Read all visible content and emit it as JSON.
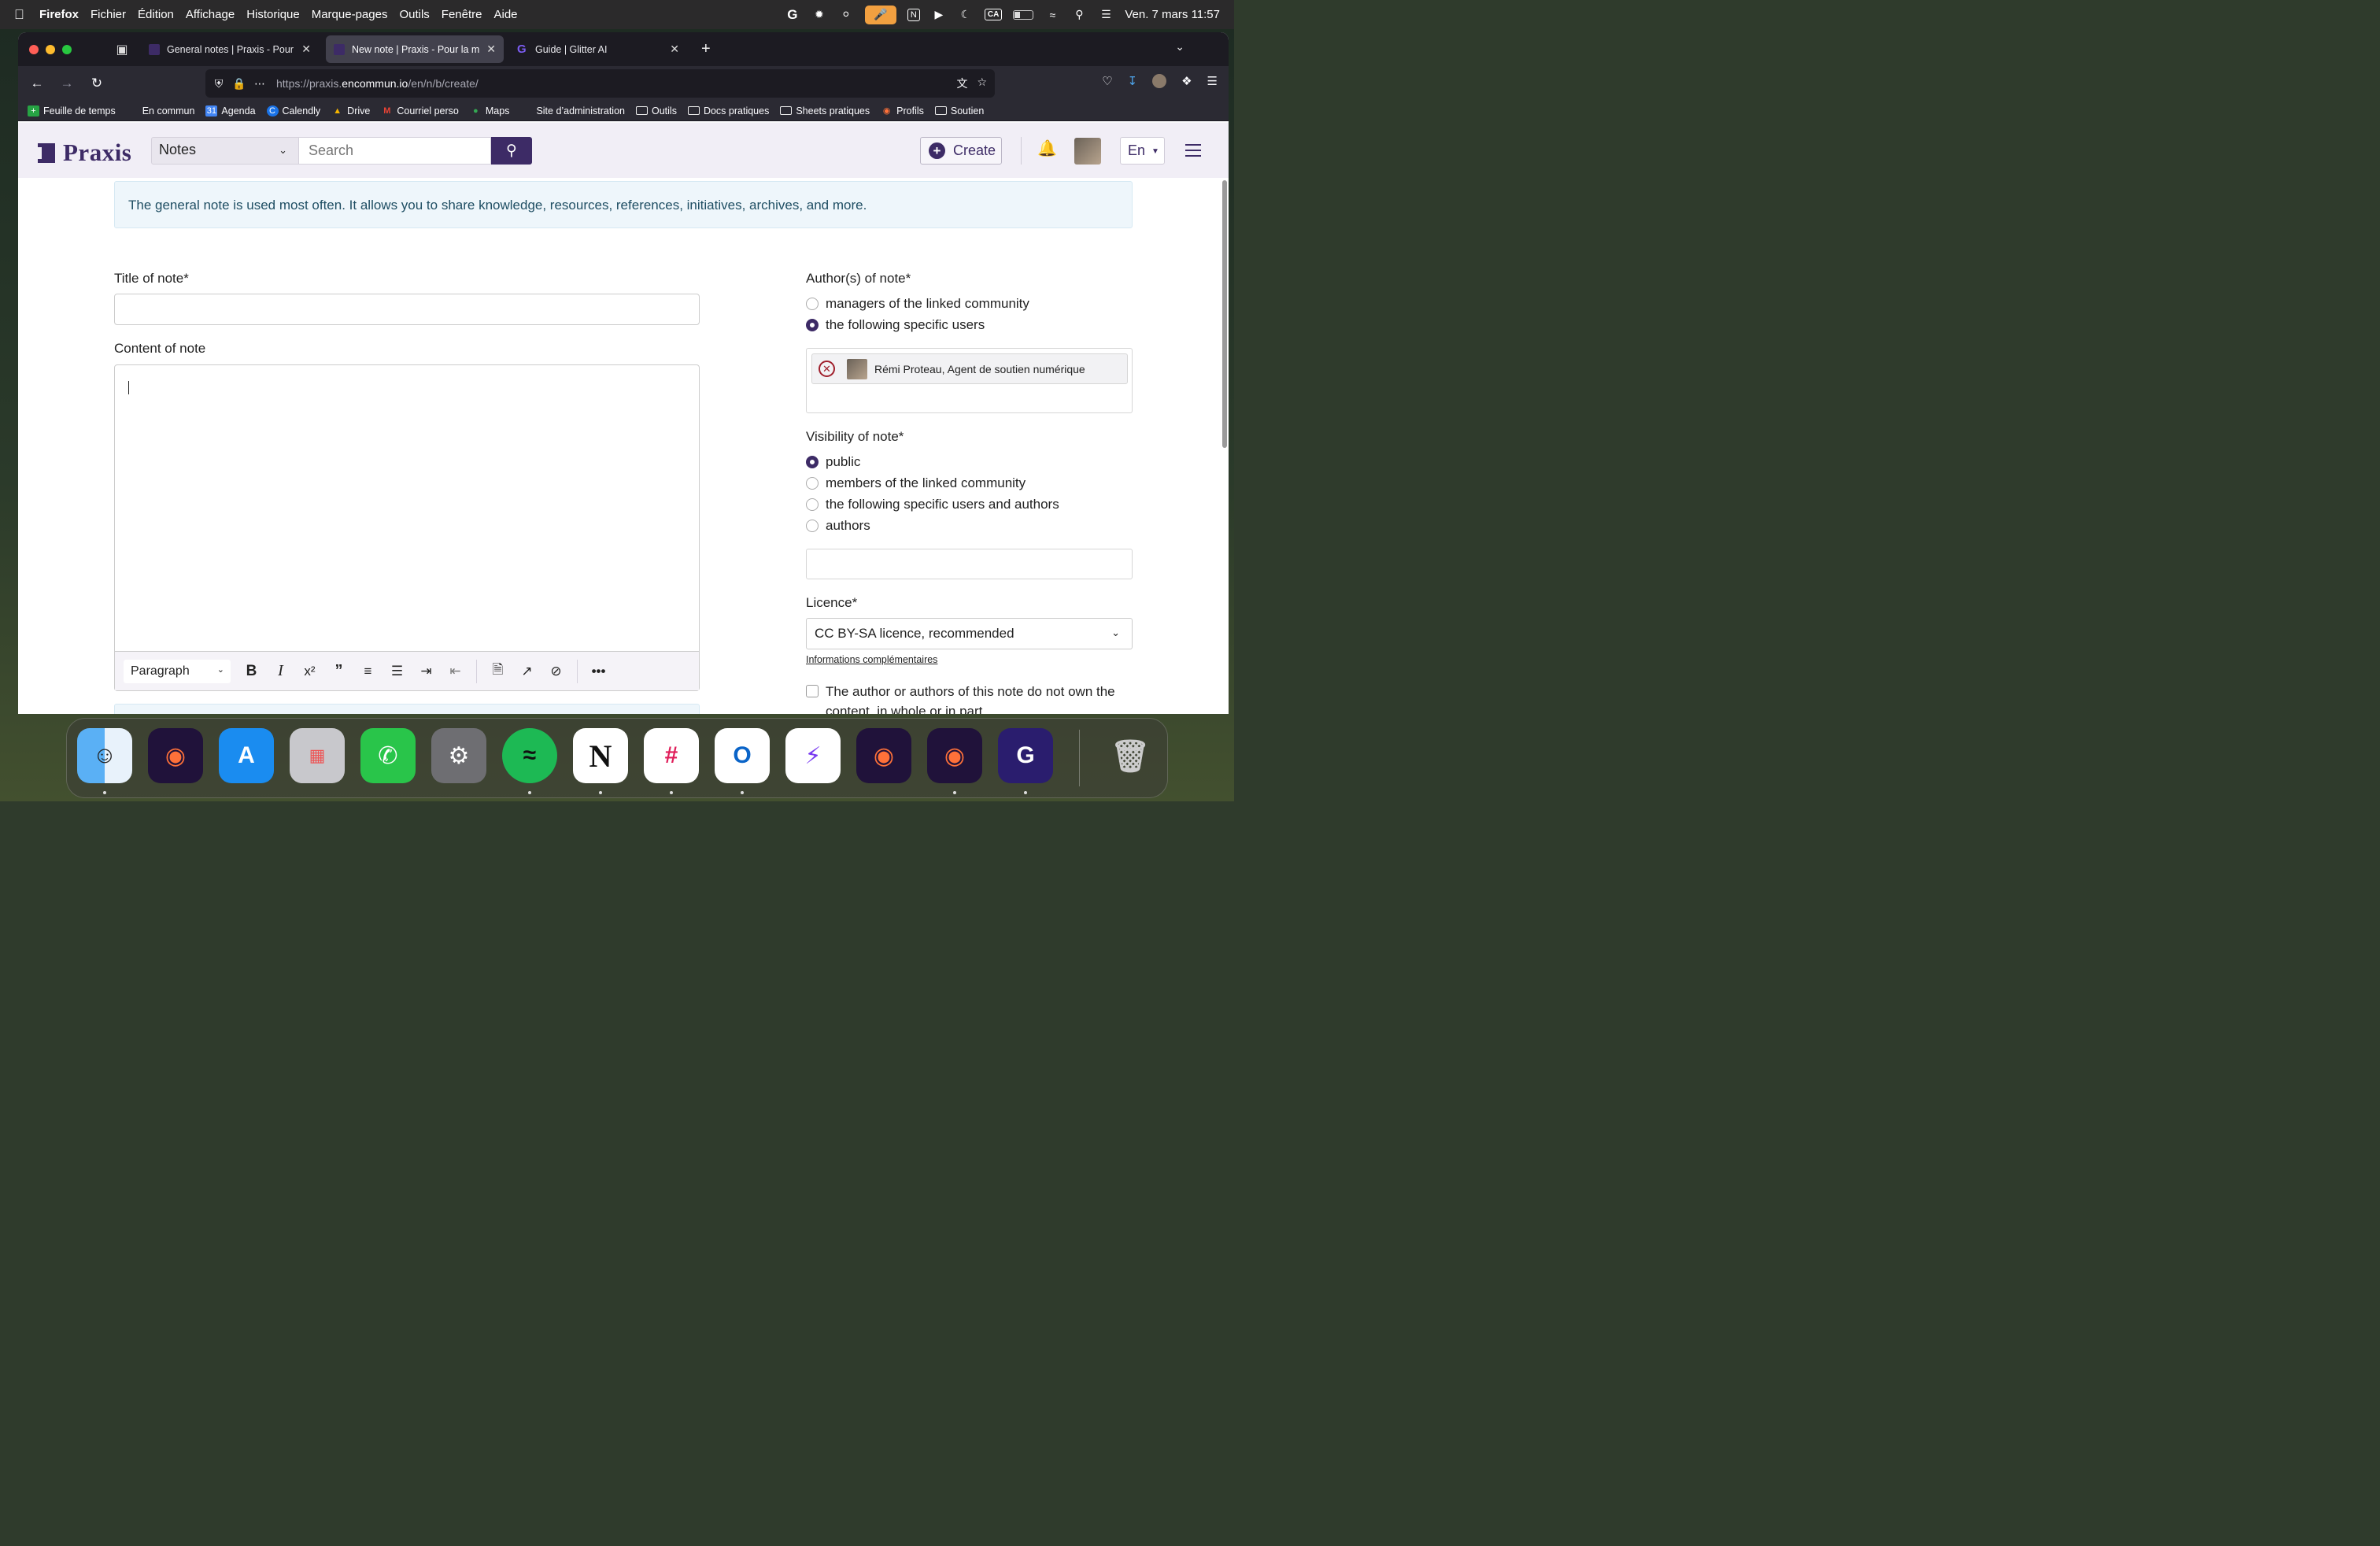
{
  "menubar": {
    "app_name": "Firefox",
    "menus": [
      "Fichier",
      "Édition",
      "Affichage",
      "Historique",
      "Marque-pages",
      "Outils",
      "Fenêtre",
      "Aide"
    ],
    "ca_badge": "CA",
    "datetime": "Ven. 7 mars 11:57"
  },
  "browser": {
    "tabs": [
      {
        "title": "General notes | Praxis - Pour la m",
        "active": false
      },
      {
        "title": "New note | Praxis - Pour la mise",
        "active": true
      },
      {
        "title": "Guide | Glitter AI",
        "active": false
      }
    ],
    "url_prefix": "https://praxis.",
    "url_domain": "encommun.io",
    "url_path": "/en/n/b/create/",
    "bookmarks": [
      "Feuille de temps",
      "En commun",
      "Agenda",
      "Calendly",
      "Drive",
      "Courriel perso",
      "Maps",
      "Site d’administration",
      "Outils",
      "Docs pratiques",
      "Sheets pratiques",
      "Profils",
      "Soutien"
    ]
  },
  "header": {
    "logo_text": "Praxis",
    "section_select": "Notes",
    "search_placeholder": "Search",
    "create_label": "Create",
    "language": "En"
  },
  "info_banner": "The general note is used most often. It allows you to share knowledge, resources, references, initiatives, archives, and more.",
  "form": {
    "title_label": "Title of note*",
    "title_value": "",
    "content_label": "Content of note",
    "paragraph_style": "Paragraph",
    "authors_label": "Author(s) of note*",
    "author_options": [
      {
        "label": "managers of the linked community",
        "selected": false
      },
      {
        "label": "the following specific users",
        "selected": true
      }
    ],
    "selected_author": "Rémi Proteau, Agent de soutien numérique",
    "visibility_label": "Visibility of note*",
    "visibility_options": [
      {
        "label": "public",
        "selected": true
      },
      {
        "label": "members of the linked community",
        "selected": false
      },
      {
        "label": "the following specific users and authors",
        "selected": false
      },
      {
        "label": "authors",
        "selected": false
      }
    ],
    "licence_label": "Licence*",
    "licence_value": "CC BY-SA licence, recommended",
    "more_info_link": "Informations complémentaires",
    "ownership_checkbox": "The author or authors of this note do not own the content, in whole or in part."
  },
  "colors": {
    "brand": "#3d2b66",
    "info_bg": "#eef6fb",
    "remove_red": "#a01f2c"
  }
}
